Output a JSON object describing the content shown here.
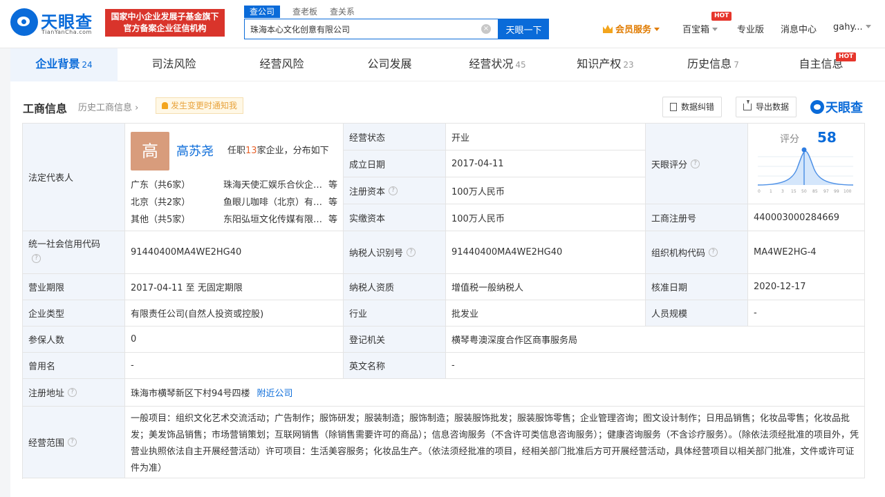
{
  "header": {
    "logo_cn": "天眼查",
    "logo_en": "TianYanCha.com",
    "gov_badge_line1": "国家中小企业发展子基金旗下",
    "gov_badge_line2": "官方备案企业征信机构",
    "search_tabs": [
      "查公司",
      "查老板",
      "查关系"
    ],
    "search_value": "珠海本心文化创意有限公司",
    "clear_icon": "×",
    "search_button": "天眼一下",
    "vip": "会员服务",
    "treasure": "百宝箱",
    "hot": "HOT",
    "pro": "专业版",
    "messages": "消息中心",
    "user": "gahy..."
  },
  "tabs": [
    {
      "label": "企业背景",
      "count": "24"
    },
    {
      "label": "司法风险",
      "count": ""
    },
    {
      "label": "经营风险",
      "count": ""
    },
    {
      "label": "公司发展",
      "count": ""
    },
    {
      "label": "经营状况",
      "count": "45"
    },
    {
      "label": "知识产权",
      "count": "23"
    },
    {
      "label": "历史信息",
      "count": "7"
    },
    {
      "label": "自主信息",
      "count": ""
    }
  ],
  "section": {
    "title": "工商信息",
    "history_link": "历史工商信息",
    "history_arrow": "›",
    "notify": "发生变更时通知我",
    "correct_btn": "数据纠错",
    "export_btn": "导出数据",
    "brand": "天眼查"
  },
  "info": {
    "legal_rep_label": "法定代表人",
    "avatar_char": "高",
    "rep_name": "高苏尧",
    "rep_pre": "任职",
    "rep_count": "13",
    "rep_post": "家企业，分布如下",
    "regions": [
      {
        "region": "广东（共",
        "num": "6",
        "suffix": "家）",
        "company": "珠海天使汇娱乐合伙企业（有限合伙）",
        "deng": "等"
      },
      {
        "region": "北京（共",
        "num": "2",
        "suffix": "家）",
        "company": "鱼眼儿咖啡（北京）有限公司",
        "deng": "等"
      },
      {
        "region": "其他（共",
        "num": "5",
        "suffix": "家）",
        "company": "东阳弘垣文化传媒有限公司",
        "deng": "等"
      }
    ],
    "status_label": "经营状态",
    "status": "开业",
    "established_label": "成立日期",
    "established": "2017-04-11",
    "reg_capital_label": "注册资本",
    "reg_capital": "100万人民币",
    "paid_capital_label": "实缴资本",
    "paid_capital": "100万人民币",
    "score_label_cell": "天眼评分",
    "score_title": "评分",
    "score": "58",
    "score_ticks": [
      "0",
      "1",
      "3",
      "15",
      "50",
      "85",
      "97",
      "99",
      "100"
    ],
    "biz_reg_label": "工商注册号",
    "biz_reg": "440003000284669",
    "credit_code_label": "统一社会信用代码",
    "credit_code": "91440400MA4WE2HG40",
    "taxpayer_id_label": "纳税人识别号",
    "taxpayer_id": "91440400MA4WE2HG40",
    "org_code_label": "组织机构代码",
    "org_code": "MA4WE2HG-4",
    "term_label": "营业期限",
    "term": "2017-04-11 至 无固定期限",
    "taxpayer_qual_label": "纳税人资质",
    "taxpayer_qual": "增值税一般纳税人",
    "approval_label": "核准日期",
    "approval": "2020-12-17",
    "type_label": "企业类型",
    "type": "有限责任公司(自然人投资或控股)",
    "industry_label": "行业",
    "industry": "批发业",
    "staff_label": "人员规模",
    "staff": "-",
    "insured_label": "参保人数",
    "insured": "0",
    "authority_label": "登记机关",
    "authority": "横琴粤澳深度合作区商事服务局",
    "former_label": "曾用名",
    "former": "-",
    "english_label": "英文名称",
    "english": "-",
    "address_label": "注册地址",
    "address": "珠海市横琴新区下村94号四楼",
    "nearby": "附近公司",
    "scope_label": "经营范围",
    "scope": "一般项目：组织文化艺术交流活动；广告制作；服饰研发；服装制造；服饰制造；服装服饰批发；服装服饰零售；企业管理咨询；图文设计制作；日用品销售；化妆品零售；化妆品批发；美发饰品销售；市场营销策划；互联网销售（除销售需要许可的商品）；信息咨询服务（不含许可类信息咨询服务）；健康咨询服务（不含诊疗服务）。（除依法须经批准的项目外，凭营业执照依法自主开展经营活动）许可项目：生活美容服务；化妆品生产。（依法须经批准的项目，经相关部门批准后方可开展经营活动，具体经营项目以相关部门批准，文件或许可证件为准）",
    "help_glyph": "?"
  }
}
